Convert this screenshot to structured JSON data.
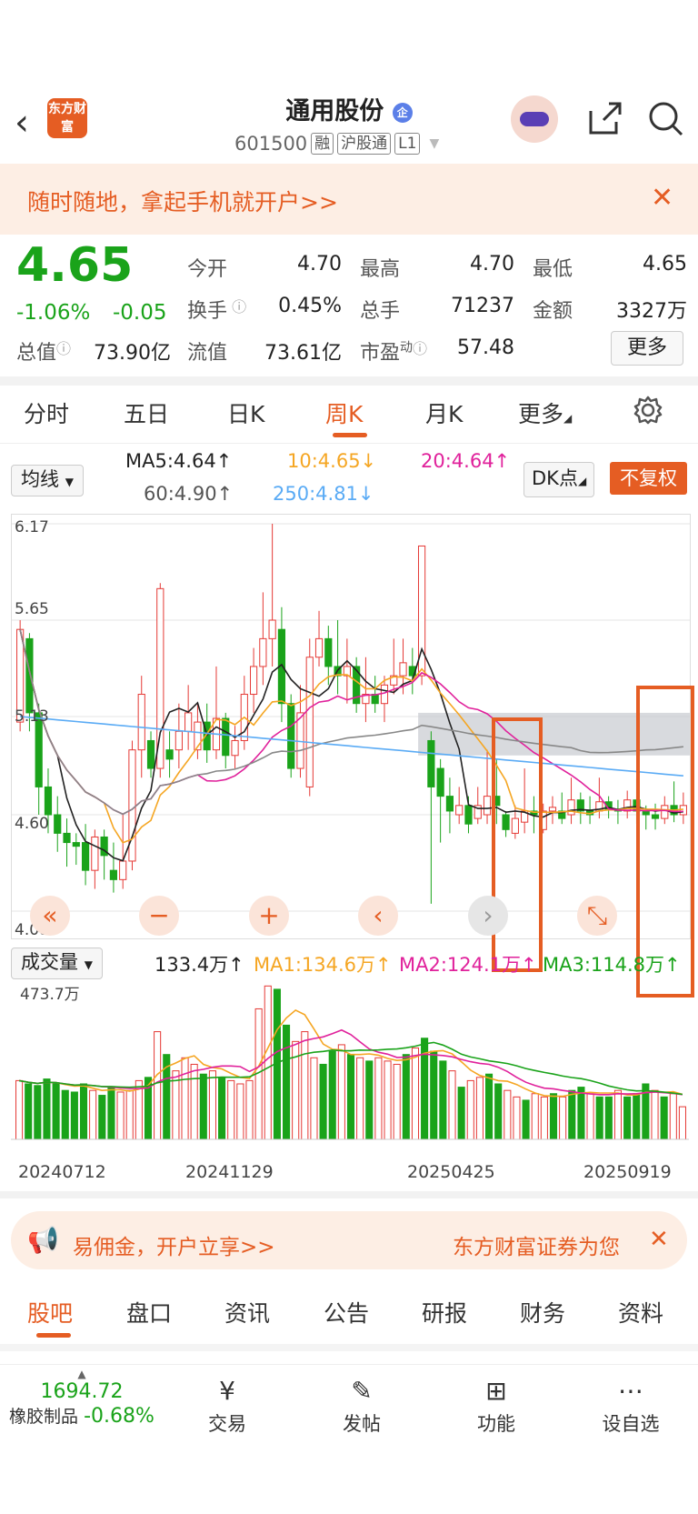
{
  "header": {
    "title": "通用股份",
    "code": "601500",
    "tags": [
      "融",
      "沪股通",
      "L1"
    ],
    "logo_text": "东方财富",
    "badge": "企"
  },
  "promo_banner": {
    "text": "随时随地，拿起手机就开户>>"
  },
  "quote": {
    "price": "4.65",
    "change_pct": "-1.06%",
    "change_amt": "-0.05",
    "open_label": "今开",
    "open": "4.70",
    "high_label": "最高",
    "high": "4.70",
    "low_label": "最低",
    "low": "4.65",
    "turnover_label": "换手",
    "turnover": "0.45%",
    "volume_label": "总手",
    "volume": "71237",
    "amount_label": "金额",
    "amount": "3327万",
    "mktcap_label": "总值",
    "mktcap": "73.90亿",
    "float_label": "流值",
    "float": "73.61亿",
    "pe_label": "市盈",
    "pe_sup": "动",
    "pe": "57.48",
    "more": "更多"
  },
  "period_tabs": [
    "分时",
    "五日",
    "日K",
    "周K",
    "月K",
    "更多"
  ],
  "active_period": "周K",
  "ma": {
    "selector": "均线",
    "ma5": "MA5:4.64↑",
    "ma10": "10:4.65↓",
    "ma20": "20:4.64↑",
    "ma60": "60:4.90↑",
    "ma250": "250:4.81↓",
    "dk": "DK点",
    "adjust": "不复权"
  },
  "colors": {
    "up": "#e53935",
    "down": "#1aa31a",
    "accent": "#e55d23",
    "ma5": "#222222",
    "ma10": "#f5a623",
    "ma20": "#e0219b",
    "ma60": "#888888",
    "ma250": "#5aabf5"
  },
  "chart_data": {
    "type": "candlestick",
    "ylim": [
      4.08,
      6.17
    ],
    "y_ticks": [
      "6.17",
      "5.65",
      "5.13",
      "4.60",
      "4.08"
    ],
    "x_labels": [
      "20240712",
      "20241129",
      "20250425",
      "20250919"
    ],
    "candles": [
      {
        "o": 5.1,
        "c": 5.6,
        "h": 5.65,
        "l": 5.05
      },
      {
        "o": 5.55,
        "c": 5.15,
        "h": 5.58,
        "l": 5.05
      },
      {
        "o": 5.15,
        "c": 4.75,
        "h": 5.2,
        "l": 4.6
      },
      {
        "o": 4.75,
        "c": 4.6,
        "h": 4.85,
        "l": 4.5
      },
      {
        "o": 4.6,
        "c": 4.5,
        "h": 4.7,
        "l": 4.4
      },
      {
        "o": 4.5,
        "c": 4.45,
        "h": 4.58,
        "l": 4.32
      },
      {
        "o": 4.45,
        "c": 4.43,
        "h": 4.5,
        "l": 4.33
      },
      {
        "o": 4.45,
        "c": 4.3,
        "h": 4.55,
        "l": 4.22
      },
      {
        "o": 4.3,
        "c": 4.48,
        "h": 4.52,
        "l": 4.2
      },
      {
        "o": 4.48,
        "c": 4.38,
        "h": 4.52,
        "l": 4.25
      },
      {
        "o": 4.3,
        "c": 4.25,
        "h": 4.45,
        "l": 4.18
      },
      {
        "o": 4.25,
        "c": 4.35,
        "h": 4.6,
        "l": 4.2
      },
      {
        "o": 4.35,
        "c": 4.95,
        "h": 5.0,
        "l": 4.3
      },
      {
        "o": 4.95,
        "c": 5.25,
        "h": 5.35,
        "l": 4.8
      },
      {
        "o": 5.0,
        "c": 4.85,
        "h": 5.05,
        "l": 4.8
      },
      {
        "o": 4.85,
        "c": 5.82,
        "h": 5.85,
        "l": 4.8
      },
      {
        "o": 4.95,
        "c": 4.9,
        "h": 5.05,
        "l": 4.8
      },
      {
        "o": 4.95,
        "c": 5.05,
        "h": 5.2,
        "l": 4.85
      },
      {
        "o": 5.05,
        "c": 5.15,
        "h": 5.3,
        "l": 4.95
      },
      {
        "o": 4.95,
        "c": 5.1,
        "h": 5.2,
        "l": 4.9
      },
      {
        "o": 5.1,
        "c": 4.95,
        "h": 5.2,
        "l": 4.88
      },
      {
        "o": 4.95,
        "c": 5.12,
        "h": 5.4,
        "l": 4.9
      },
      {
        "o": 5.12,
        "c": 4.92,
        "h": 5.15,
        "l": 4.85
      },
      {
        "o": 4.92,
        "c": 5.0,
        "h": 5.08,
        "l": 4.85
      },
      {
        "o": 5.0,
        "c": 5.25,
        "h": 5.35,
        "l": 4.95
      },
      {
        "o": 5.25,
        "c": 5.4,
        "h": 5.5,
        "l": 5.15
      },
      {
        "o": 5.4,
        "c": 5.55,
        "h": 5.8,
        "l": 5.3
      },
      {
        "o": 5.55,
        "c": 5.65,
        "h": 6.17,
        "l": 5.4
      },
      {
        "o": 5.6,
        "c": 5.2,
        "h": 5.72,
        "l": 5.1
      },
      {
        "o": 5.2,
        "c": 4.85,
        "h": 5.25,
        "l": 4.8
      },
      {
        "o": 4.85,
        "c": 5.15,
        "h": 5.3,
        "l": 4.8
      },
      {
        "o": 4.75,
        "c": 5.45,
        "h": 5.55,
        "l": 4.7
      },
      {
        "o": 5.45,
        "c": 5.55,
        "h": 5.7,
        "l": 5.4
      },
      {
        "o": 5.55,
        "c": 5.4,
        "h": 5.62,
        "l": 5.3
      },
      {
        "o": 5.4,
        "c": 5.35,
        "h": 5.65,
        "l": 5.25
      },
      {
        "o": 5.35,
        "c": 5.4,
        "h": 5.55,
        "l": 5.2
      },
      {
        "o": 5.4,
        "c": 5.2,
        "h": 5.45,
        "l": 5.15
      },
      {
        "o": 5.2,
        "c": 5.25,
        "h": 5.45,
        "l": 5.1
      },
      {
        "o": 5.25,
        "c": 5.2,
        "h": 5.35,
        "l": 5.15
      },
      {
        "o": 5.2,
        "c": 5.3,
        "h": 5.35,
        "l": 5.1
      },
      {
        "o": 5.3,
        "c": 5.35,
        "h": 5.55,
        "l": 5.25
      },
      {
        "o": 5.35,
        "c": 5.42,
        "h": 5.55,
        "l": 5.25
      },
      {
        "o": 5.4,
        "c": 5.35,
        "h": 5.5,
        "l": 5.25
      },
      {
        "o": 5.35,
        "c": 6.05,
        "h": 6.05,
        "l": 5.3
      },
      {
        "o": 5.0,
        "c": 4.75,
        "h": 5.05,
        "l": 4.12
      },
      {
        "o": 4.85,
        "c": 4.7,
        "h": 4.9,
        "l": 4.45
      },
      {
        "o": 4.7,
        "c": 4.62,
        "h": 4.8,
        "l": 4.5
      },
      {
        "o": 4.6,
        "c": 4.65,
        "h": 4.75,
        "l": 4.55
      },
      {
        "o": 4.65,
        "c": 4.55,
        "h": 4.7,
        "l": 4.5
      },
      {
        "o": 4.58,
        "c": 4.65,
        "h": 4.75,
        "l": 4.55
      },
      {
        "o": 4.6,
        "c": 4.7,
        "h": 4.95,
        "l": 4.55
      },
      {
        "o": 4.7,
        "c": 4.65,
        "h": 4.9,
        "l": 4.55
      },
      {
        "o": 4.6,
        "c": 4.52,
        "h": 4.62,
        "l": 4.48
      },
      {
        "o": 4.5,
        "c": 4.58,
        "h": 4.65,
        "l": 4.47
      },
      {
        "o": 4.56,
        "c": 4.62,
        "h": 4.85,
        "l": 4.5
      },
      {
        "o": 4.62,
        "c": 4.6,
        "h": 4.7,
        "l": 4.5
      },
      {
        "o": 4.52,
        "c": 4.62,
        "h": 4.66,
        "l": 4.5
      },
      {
        "o": 4.62,
        "c": 4.64,
        "h": 4.7,
        "l": 4.55
      },
      {
        "o": 4.62,
        "c": 4.58,
        "h": 4.72,
        "l": 4.55
      },
      {
        "o": 4.6,
        "c": 4.68,
        "h": 4.8,
        "l": 4.55
      },
      {
        "o": 4.68,
        "c": 4.62,
        "h": 4.72,
        "l": 4.55
      },
      {
        "o": 4.62,
        "c": 4.6,
        "h": 4.7,
        "l": 4.55
      },
      {
        "o": 4.62,
        "c": 4.67,
        "h": 4.8,
        "l": 4.58
      },
      {
        "o": 4.67,
        "c": 4.63,
        "h": 4.7,
        "l": 4.58
      },
      {
        "o": 4.63,
        "c": 4.62,
        "h": 4.68,
        "l": 4.55
      },
      {
        "o": 4.62,
        "c": 4.68,
        "h": 4.73,
        "l": 4.58
      },
      {
        "o": 4.68,
        "c": 4.62,
        "h": 4.8,
        "l": 4.55
      },
      {
        "o": 4.62,
        "c": 4.6,
        "h": 4.65,
        "l": 4.52
      },
      {
        "o": 4.6,
        "c": 4.58,
        "h": 4.66,
        "l": 4.52
      },
      {
        "o": 4.58,
        "c": 4.65,
        "h": 4.7,
        "l": 4.55
      },
      {
        "o": 4.65,
        "c": 4.6,
        "h": 4.78,
        "l": 4.56
      },
      {
        "o": 4.6,
        "c": 4.65,
        "h": 4.72,
        "l": 4.55
      }
    ],
    "volume": {
      "ylim": [
        0,
        473.7
      ],
      "top_label": "473.7万",
      "values": [
        180,
        170,
        165,
        185,
        170,
        150,
        145,
        170,
        150,
        135,
        160,
        145,
        150,
        180,
        190,
        330,
        260,
        210,
        250,
        230,
        200,
        210,
        190,
        180,
        170,
        180,
        400,
        470,
        460,
        350,
        300,
        330,
        250,
        230,
        270,
        290,
        260,
        250,
        240,
        250,
        240,
        230,
        260,
        280,
        310,
        270,
        240,
        210,
        160,
        180,
        190,
        200,
        170,
        150,
        130,
        120,
        140,
        130,
        140,
        130,
        150,
        160,
        140,
        130,
        130,
        150,
        130,
        140,
        170,
        150,
        130,
        140,
        100
      ],
      "volume_label": "成交量",
      "vol_value": "133.4万↑",
      "ma1": "MA1:134.6万↑",
      "ma2": "MA2:124.1万↑",
      "ma3": "MA3:114.8万↑"
    }
  },
  "chart_controls": [
    "«",
    "−",
    "+",
    "‹",
    "›",
    "⤡"
  ],
  "ad": {
    "text": "易佣金，开户立享>>",
    "text2": "东方财富证券为您"
  },
  "section_tabs": [
    "股吧",
    "盘口",
    "资讯",
    "公告",
    "研报",
    "财务",
    "资料"
  ],
  "bottom_nav": {
    "index_value": "1694.72",
    "index_name": "橡胶制品",
    "index_change": "-0.68%",
    "items": [
      "交易",
      "发帖",
      "功能",
      "设自选"
    ]
  }
}
